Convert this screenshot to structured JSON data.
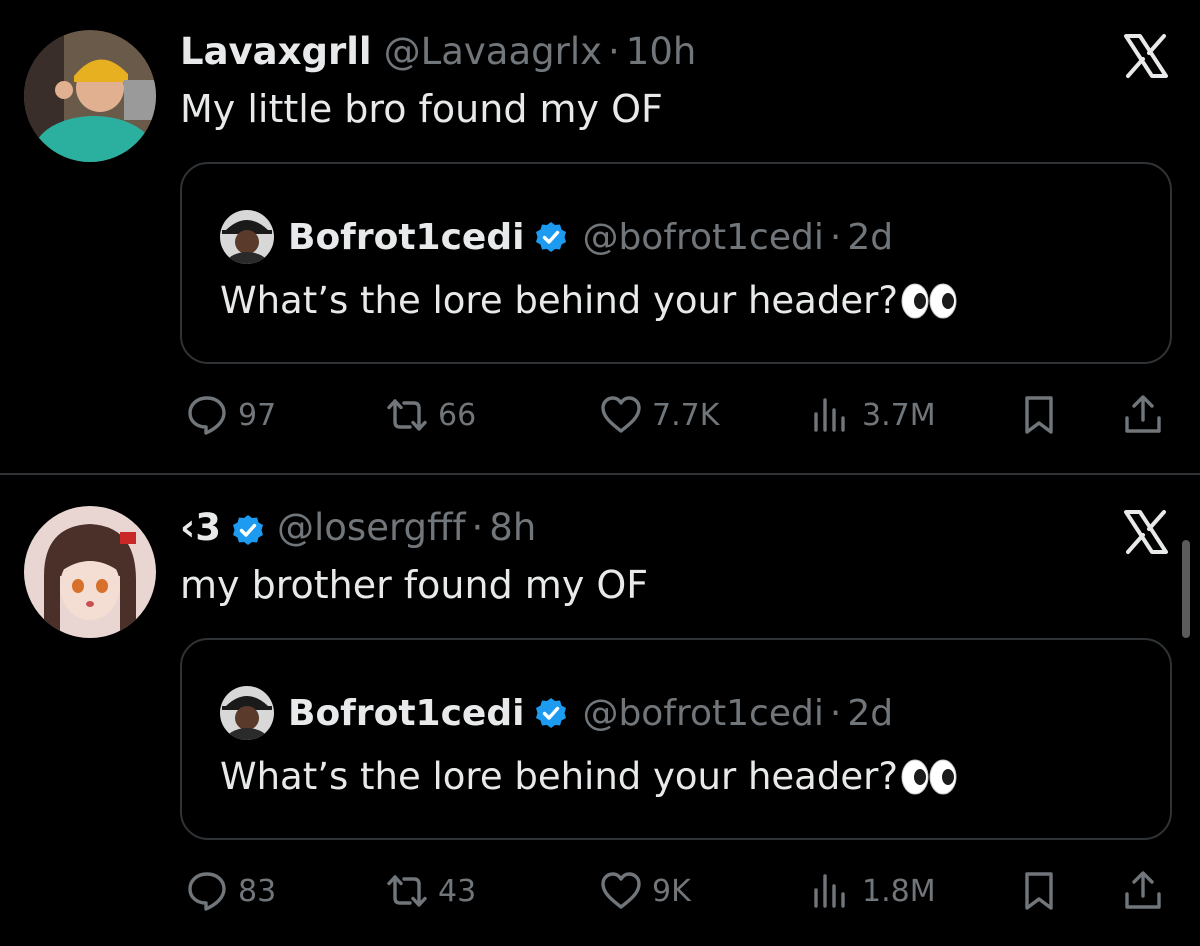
{
  "tweets": [
    {
      "author": {
        "name": "Lavaxgrll",
        "handle": "@Lavaagrlx",
        "verified": false
      },
      "separator": "·",
      "time": "10h",
      "text": "My little bro found my OF",
      "quote": {
        "name": "Bofrot1cedi",
        "handle": "@bofrot1cedi",
        "separator": "·",
        "time": "2d",
        "text": "What’s the lore behind your header?",
        "emoji": "eyes-emoji"
      },
      "stats": {
        "replies": "97",
        "reposts": "66",
        "likes": "7.7K",
        "views": "3.7M"
      }
    },
    {
      "author": {
        "name": "‹3",
        "handle": "@losergfff",
        "verified": true
      },
      "separator": "·",
      "time": "8h",
      "text": "my brother found my OF",
      "quote": {
        "name": "Bofrot1cedi",
        "handle": "@bofrot1cedi",
        "separator": "·",
        "time": "2d",
        "text": "What’s the lore behind your header?",
        "emoji": "eyes-emoji"
      },
      "stats": {
        "replies": "83",
        "reposts": "43",
        "likes": "9K",
        "views": "1.8M"
      }
    }
  ],
  "icons": {
    "reply": "speech-bubble-icon",
    "repost": "repost-arrows-icon",
    "like": "heart-icon",
    "views": "bar-chart-icon",
    "bookmark": "bookmark-icon",
    "share": "share-icon",
    "dismiss": "x-logo-icon",
    "verified": "verified-badge-icon"
  },
  "colors": {
    "background": "#000000",
    "text": "#e7e9ea",
    "muted": "#71767b",
    "border": "#2f3336",
    "verified": "#1d9bf0"
  }
}
